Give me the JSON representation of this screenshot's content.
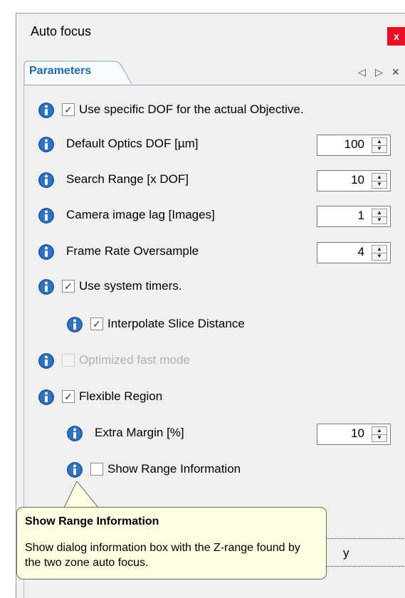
{
  "window": {
    "title": "Auto focus",
    "close_label": "x",
    "accent_color": "#e81123"
  },
  "tabs": {
    "active_label": "Parameters",
    "controls": {
      "left": "◁",
      "right": "▷",
      "close": "✕"
    }
  },
  "rows": [
    {
      "type": "checkbox",
      "checked": true,
      "enabled": true,
      "label": "Use specific DOF for the actual Objective."
    },
    {
      "type": "spin",
      "label": "Default Optics DOF [µm]",
      "value": "100"
    },
    {
      "type": "spin",
      "label": "Search Range [x DOF]",
      "value": "10"
    },
    {
      "type": "spin",
      "label": "Camera image lag [Images]",
      "value": "1"
    },
    {
      "type": "spin",
      "label": "Frame Rate Oversample",
      "value": "4"
    },
    {
      "type": "checkbox",
      "checked": true,
      "enabled": true,
      "label": "Use system timers."
    },
    {
      "type": "checkbox",
      "checked": true,
      "enabled": true,
      "indent": true,
      "label": "Interpolate Slice Distance"
    },
    {
      "type": "checkbox",
      "checked": false,
      "enabled": false,
      "label": "Optimized fast mode"
    },
    {
      "type": "checkbox",
      "checked": true,
      "enabled": true,
      "label": "Flexible Region"
    },
    {
      "type": "spin",
      "indent": true,
      "label": "Extra Margin [%]",
      "value": "10"
    },
    {
      "type": "checkbox",
      "checked": false,
      "enabled": true,
      "indent": true,
      "label": "Show Range Information"
    }
  ],
  "ok_button": {
    "label_visible": "y"
  },
  "tooltip": {
    "title": "Show Range Information",
    "body": "Show dialog information box with the Z-range found by the two zone auto focus."
  },
  "icons": {
    "info": "info-icon",
    "check": "check-icon",
    "spin_up": "spin-up-arrow-icon",
    "spin_down": "spin-down-arrow-icon"
  },
  "colors": {
    "info_icon": "#1e5ba8",
    "tooltip_bg": "#ffffe1",
    "tab_text": "#1c6bb8"
  }
}
